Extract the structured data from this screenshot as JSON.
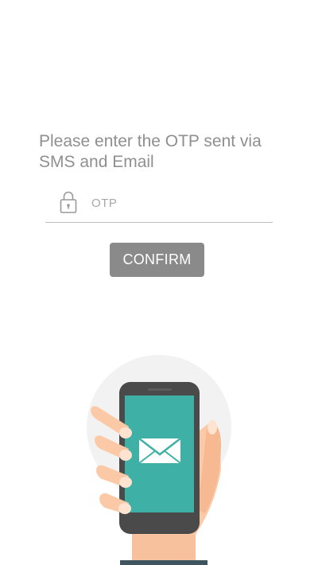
{
  "otp_screen": {
    "instruction": "Please enter the OTP sent via SMS and Email",
    "otp_placeholder": "OTP",
    "otp_value": "",
    "confirm_label": "CONFIRM"
  },
  "icons": {
    "lock": "lock-icon",
    "phone": "phone-icon",
    "envelope": "envelope-icon",
    "hand": "hand-illustration"
  },
  "colors": {
    "instruction_text": "#8f8f8f",
    "button_bg": "#8a8a8a",
    "button_text": "#ffffff",
    "phone_screen": "#3fb0a6",
    "phone_body": "#4a4a4a",
    "skin": "#fcc9a6"
  }
}
